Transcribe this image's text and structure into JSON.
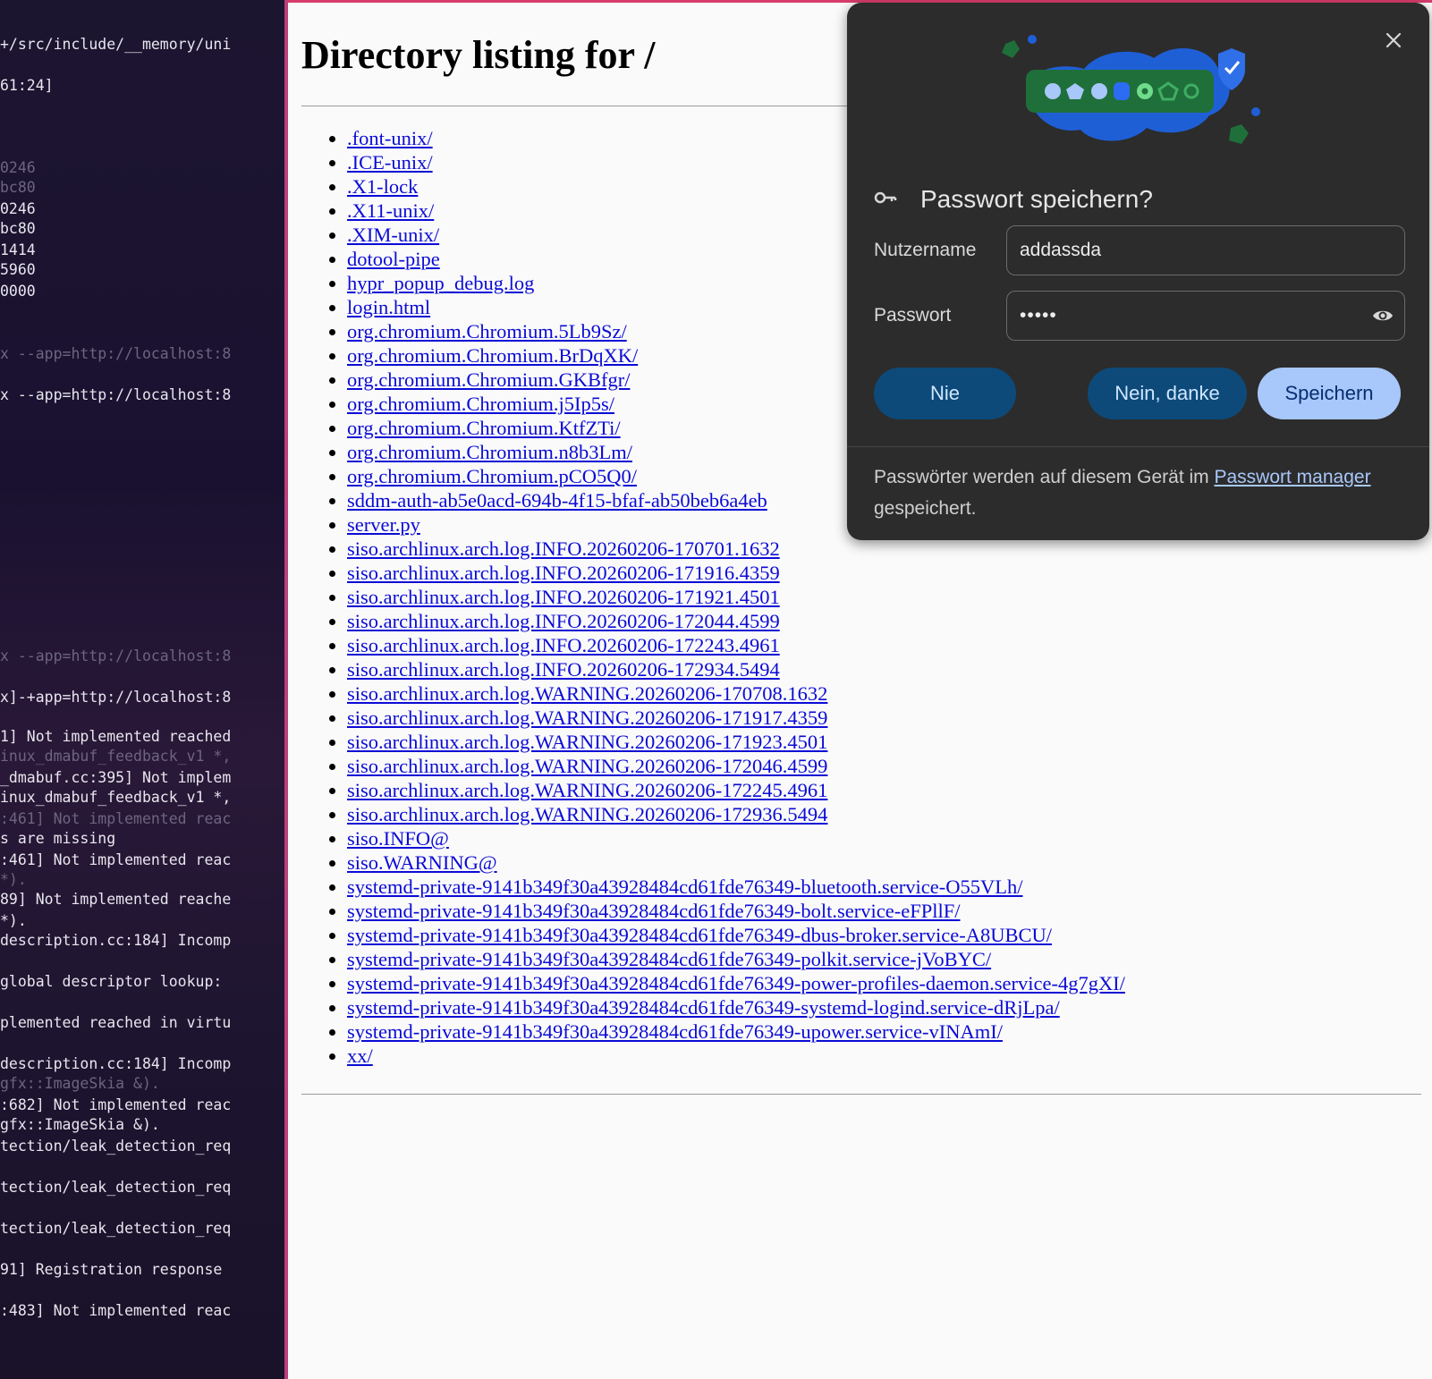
{
  "terminal": {
    "lines": [
      {
        "text": "+/src/include/__memory/uni",
        "dim": false
      },
      {
        "text": "61:24]",
        "dim": false
      },
      {
        "text": "0246",
        "dim": true
      },
      {
        "text": "bc80",
        "dim": true
      },
      {
        "text": "0246",
        "dim": false
      },
      {
        "text": "bc80",
        "dim": false
      },
      {
        "text": "1414",
        "dim": false
      },
      {
        "text": "5960",
        "dim": false
      },
      {
        "text": "0000",
        "dim": false
      },
      {
        "text": "x --app=http://localhost:8",
        "dim": true
      },
      {
        "text": "x --app=http://localhost:8",
        "dim": false
      },
      {
        "text": "x --app=http://localhost:8",
        "dim": true
      },
      {
        "text": "x]-+app=http://localhost:8",
        "dim": false
      },
      {
        "text": "1] Not implemented reached",
        "dim": false
      },
      {
        "text": "inux_dmabuf_feedback_v1 *,",
        "dim": true
      },
      {
        "text": "_dmabuf.cc:395] Not implem",
        "dim": false
      },
      {
        "text": "inux_dmabuf_feedback_v1 *,",
        "dim": false
      },
      {
        "text": ":461] Not implemented reac",
        "dim": true
      },
      {
        "text": "s are missing",
        "dim": false
      },
      {
        "text": ":461] Not implemented reac",
        "dim": false
      },
      {
        "text": "*).",
        "dim": true
      },
      {
        "text": "89] Not implemented reache",
        "dim": false
      },
      {
        "text": "*).",
        "dim": false
      },
      {
        "text": "description.cc:184] Incomp",
        "dim": false
      },
      {
        "text": "global descriptor lookup:",
        "dim": false
      },
      {
        "text": "plemented reached in virtu",
        "dim": false
      },
      {
        "text": "description.cc:184] Incomp",
        "dim": false
      },
      {
        "text": "gfx::ImageSkia &).",
        "dim": true
      },
      {
        "text": ":682] Not implemented reac",
        "dim": false
      },
      {
        "text": "gfx::ImageSkia &).",
        "dim": false
      },
      {
        "text": "tection/leak_detection_req",
        "dim": false
      },
      {
        "text": "tection/leak_detection_req",
        "dim": false
      },
      {
        "text": "tection/leak_detection_req",
        "dim": false
      },
      {
        "text": "91] Registration response",
        "dim": false
      },
      {
        "text": ":483] Not implemented reac",
        "dim": false
      }
    ]
  },
  "page": {
    "heading": "Directory listing for /",
    "entries": [
      ".font-unix/",
      ".ICE-unix/",
      ".X1-lock",
      ".X11-unix/",
      ".XIM-unix/",
      "dotool-pipe",
      "hypr_popup_debug.log",
      "login.html",
      "org.chromium.Chromium.5Lb9Sz/",
      "org.chromium.Chromium.BrDqXK/",
      "org.chromium.Chromium.GKBfgr/",
      "org.chromium.Chromium.j5Ip5s/",
      "org.chromium.Chromium.KtfZTi/",
      "org.chromium.Chromium.n8b3Lm/",
      "org.chromium.Chromium.pCO5Q0/",
      "sddm-auth-ab5e0acd-694b-4f15-bfaf-ab50beb6a4eb",
      "server.py",
      "siso.archlinux.arch.log.INFO.20260206-170701.1632",
      "siso.archlinux.arch.log.INFO.20260206-171916.4359",
      "siso.archlinux.arch.log.INFO.20260206-171921.4501",
      "siso.archlinux.arch.log.INFO.20260206-172044.4599",
      "siso.archlinux.arch.log.INFO.20260206-172243.4961",
      "siso.archlinux.arch.log.INFO.20260206-172934.5494",
      "siso.archlinux.arch.log.WARNING.20260206-170708.1632",
      "siso.archlinux.arch.log.WARNING.20260206-171917.4359",
      "siso.archlinux.arch.log.WARNING.20260206-171923.4501",
      "siso.archlinux.arch.log.WARNING.20260206-172046.4599",
      "siso.archlinux.arch.log.WARNING.20260206-172245.4961",
      "siso.archlinux.arch.log.WARNING.20260206-172936.5494",
      "siso.INFO@",
      "siso.WARNING@",
      "systemd-private-9141b349f30a43928484cd61fde76349-bluetooth.service-O55VLh/",
      "systemd-private-9141b349f30a43928484cd61fde76349-bolt.service-eFPllF/",
      "systemd-private-9141b349f30a43928484cd61fde76349-dbus-broker.service-A8UBCU/",
      "systemd-private-9141b349f30a43928484cd61fde76349-polkit.service-jVoBYC/",
      "systemd-private-9141b349f30a43928484cd61fde76349-power-profiles-daemon.service-4g7gXI/",
      "systemd-private-9141b349f30a43928484cd61fde76349-systemd-logind.service-dRjLpa/",
      "systemd-private-9141b349f30a43928484cd61fde76349-upower.service-vINAmI/",
      "xx/"
    ]
  },
  "dialog": {
    "title": "Passwort speichern?",
    "username_label": "Nutzername",
    "username_value": "addassda",
    "password_label": "Passwort",
    "password_value": "•••••",
    "btn_never": "Nie",
    "btn_no_thanks": "Nein, danke",
    "btn_save": "Speichern",
    "footer_before": "Passwörter werden auf diesem Gerät im ",
    "footer_link": "Passwort manager",
    "footer_after": " gespeichert.",
    "colors": {
      "accent": "#a8c7fa",
      "dark_button": "#0d4a7a",
      "background": "#2c2c2c"
    }
  }
}
